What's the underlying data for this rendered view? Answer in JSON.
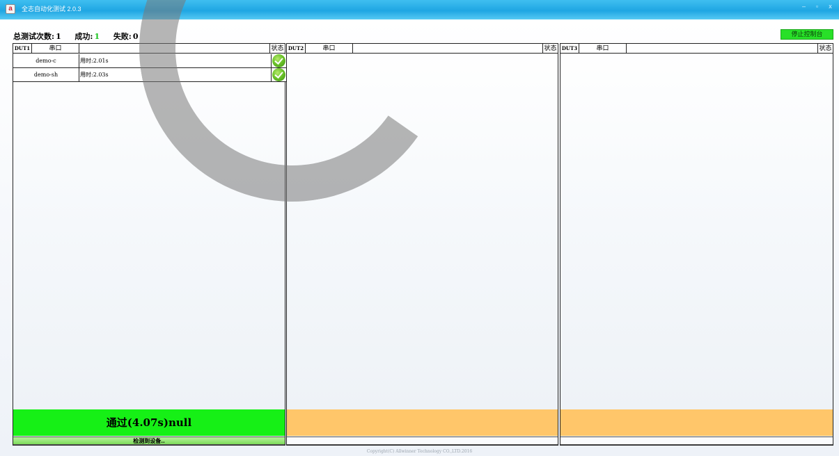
{
  "window": {
    "title": "全志自动化测试 2.0.3",
    "app_icon": "app-logo-icon",
    "controls": [
      "–",
      "▫",
      "x"
    ]
  },
  "header": {
    "total_label": "总测试次数:",
    "total_value": "1",
    "success_label": "成功:",
    "success_value": "1",
    "fail_label": "失败:",
    "fail_value": "0",
    "stop_button": "停止控制台"
  },
  "columns": {
    "port": "串口",
    "status": "状态"
  },
  "panels": [
    {
      "id": "DUT1",
      "rows": [
        {
          "name": "demo-c",
          "time": "用时:2.01s",
          "status": "check-icon"
        },
        {
          "name": "demo-sh",
          "time": "用时:2.03s",
          "status": "check-icon"
        }
      ],
      "result": "通过(4.07s)null",
      "device_status": "检测到设备.."
    },
    {
      "id": "DUT2",
      "rows": [],
      "result": "",
      "device_status": ""
    },
    {
      "id": "DUT3",
      "rows": [],
      "result": "",
      "device_status": ""
    }
  ],
  "colors": {
    "titlebar": "#1fa6e3",
    "pass": "#16f016",
    "idle": "#ffc66a",
    "stop_button": "#28e028",
    "success_text": "#19c31f"
  },
  "footer": {
    "copyright": "Copyright(C) Allwinner Technology CO.,LTD.2016"
  }
}
